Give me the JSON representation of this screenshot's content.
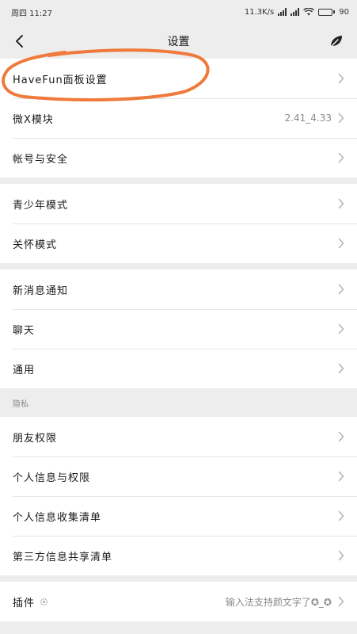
{
  "status_bar": {
    "time": "周四 11:27",
    "net_speed": "11.3K/s",
    "battery": "90",
    "battery_level": 0.9
  },
  "nav": {
    "title": "设置",
    "back_icon": "chevron-left-icon",
    "right_icon": "leaf-icon"
  },
  "groups": [
    {
      "items": [
        {
          "label": "HaveFun面板设置",
          "value": ""
        },
        {
          "label": "微X模块",
          "value": "2.41_4.33"
        },
        {
          "label": "帐号与安全",
          "value": ""
        }
      ]
    },
    {
      "items": [
        {
          "label": "青少年模式",
          "value": ""
        },
        {
          "label": "关怀模式",
          "value": ""
        }
      ]
    },
    {
      "items": [
        {
          "label": "新消息通知",
          "value": ""
        },
        {
          "label": "聊天",
          "value": ""
        },
        {
          "label": "通用",
          "value": ""
        }
      ]
    },
    {
      "header": "隐私",
      "items": [
        {
          "label": "朋友权限",
          "value": ""
        },
        {
          "label": "个人信息与权限",
          "value": ""
        },
        {
          "label": "个人信息收集清单",
          "value": ""
        },
        {
          "label": "第三方信息共享清单",
          "value": ""
        }
      ]
    },
    {
      "items": [
        {
          "label": "插件",
          "value": "输入法支持颜文字了✪_✪"
        }
      ]
    }
  ],
  "colors": {
    "background": "#ededed",
    "row": "#ffffff",
    "annotation": "#f07a3c"
  }
}
